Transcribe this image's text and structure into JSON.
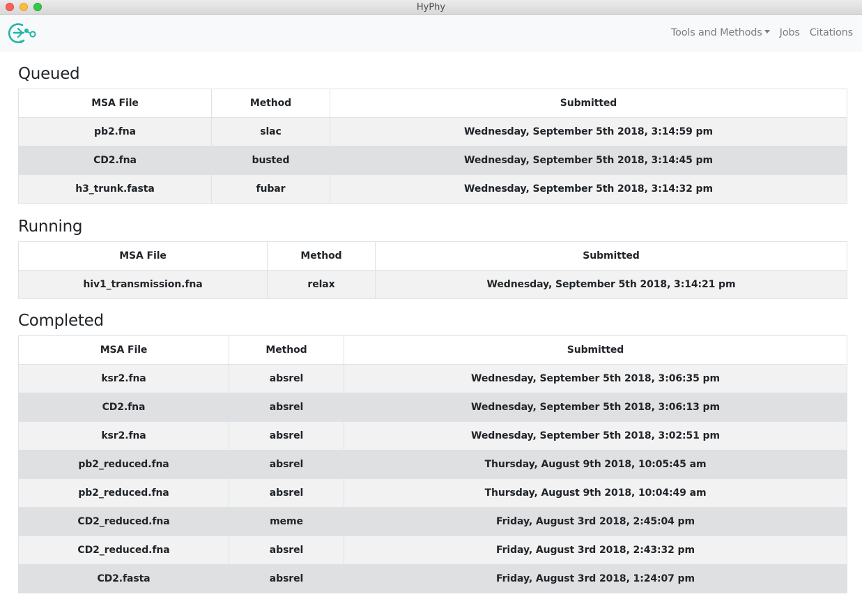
{
  "window": {
    "title": "HyPhy"
  },
  "nav": {
    "logo": "hyphy-logo",
    "links": [
      "Tools and Methods",
      "Jobs",
      "Citations"
    ]
  },
  "columns": [
    "MSA File",
    "Method",
    "Submitted"
  ],
  "sections": {
    "queued": {
      "title": "Queued",
      "rows": [
        [
          "pb2.fna",
          "slac",
          "Wednesday, September 5th 2018, 3:14:59 pm"
        ],
        [
          "CD2.fna",
          "busted",
          "Wednesday, September 5th 2018, 3:14:45 pm"
        ],
        [
          "h3_trunk.fasta",
          "fubar",
          "Wednesday, September 5th 2018, 3:14:32 pm"
        ]
      ]
    },
    "running": {
      "title": "Running",
      "rows": [
        [
          "hiv1_transmission.fna",
          "relax",
          "Wednesday, September 5th 2018, 3:14:21 pm"
        ]
      ]
    },
    "completed": {
      "title": "Completed",
      "rows": [
        [
          "ksr2.fna",
          "absrel",
          "Wednesday, September 5th 2018, 3:06:35 pm"
        ],
        [
          "CD2.fna",
          "absrel",
          "Wednesday, September 5th 2018, 3:06:13 pm"
        ],
        [
          "ksr2.fna",
          "absrel",
          "Wednesday, September 5th 2018, 3:02:51 pm"
        ],
        [
          "pb2_reduced.fna",
          "absrel",
          "Thursday, August 9th 2018, 10:05:45 am"
        ],
        [
          "pb2_reduced.fna",
          "absrel",
          "Thursday, August 9th 2018, 10:04:49 am"
        ],
        [
          "CD2_reduced.fna",
          "meme",
          "Friday, August 3rd 2018, 2:45:04 pm"
        ],
        [
          "CD2_reduced.fna",
          "absrel",
          "Friday, August 3rd 2018, 2:43:32 pm"
        ],
        [
          "CD2.fasta",
          "absrel",
          "Friday, August 3rd 2018, 1:24:07 pm"
        ]
      ]
    }
  },
  "colors": {
    "accent": "#1fb5a8",
    "navbar": "#f8f9fa",
    "row_odd": "#f2f2f2",
    "row_even": "#dee0e2"
  }
}
